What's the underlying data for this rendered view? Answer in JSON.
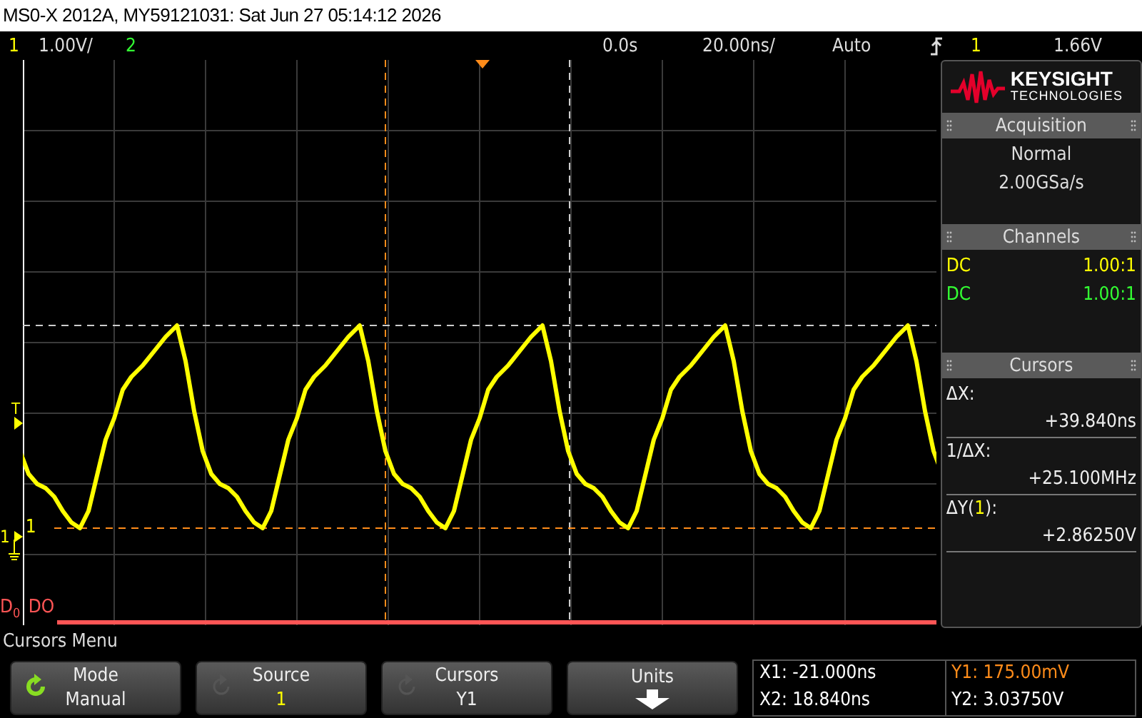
{
  "title": "MS0-X 2012A, MY59121031: Sat Jun 27 05:14:12 2026",
  "status": {
    "ch1_number": "1",
    "ch1_scale": "1.00V/",
    "ch2_number": "2",
    "time_delay": "0.0s",
    "time_scale": "20.00ns/",
    "trigger_mode": "Auto",
    "trigger_source": "1",
    "trigger_level": "1.66V"
  },
  "markers": {
    "trigger_label": "T",
    "channel_number": "1",
    "channel_label": "1",
    "digital_label": "D$_{0}$",
    "digital_name": "DO"
  },
  "logo": {
    "name": "KEYSIGHT",
    "subtitle": "TECHNOLOGIES"
  },
  "acquisition": {
    "title": "Acquisition",
    "mode": "Normal",
    "rate": "2.00GSa/s"
  },
  "channels": {
    "title": "Channels",
    "rows": [
      {
        "coupling": "DC",
        "probe": "1.00:1",
        "color": "#ffff00"
      },
      {
        "coupling": "DC",
        "probe": "1.00:1",
        "color": "#33ff33"
      }
    ]
  },
  "cursors": {
    "title": "Cursors",
    "rows": [
      {
        "label": [
          {
            "text": "ΔX:"
          }
        ],
        "value": "+39.840ns"
      },
      {
        "label": [
          {
            "text": "1/ΔX:"
          }
        ],
        "value": "+25.100MHz"
      },
      {
        "label": [
          {
            "text": "ΔY("
          },
          {
            "text": "1",
            "color": "#ffff00"
          },
          {
            "text": "):"
          }
        ],
        "value": "+2.86250V"
      }
    ]
  },
  "menu_title": "Cursors Menu",
  "softkeys": [
    {
      "kind": "rotate",
      "label": "Mode",
      "value": "Manual",
      "enabled": true
    },
    {
      "kind": "rotate",
      "label": "Source",
      "value": "1",
      "enabled": false,
      "color": "#ffff00"
    },
    {
      "kind": "rotate",
      "label": "Cursors",
      "value": "Y1",
      "enabled": false
    },
    {
      "kind": "submenu",
      "label": "Units"
    }
  ],
  "readout": [
    {
      "text": "X1: -21.000ns"
    },
    {
      "text": "Y1: 175.00mV",
      "color": "#ff8c1a"
    },
    {
      "text": "X2: 18.840ns"
    },
    {
      "text": "Y2: 3.03750V"
    }
  ]
}
